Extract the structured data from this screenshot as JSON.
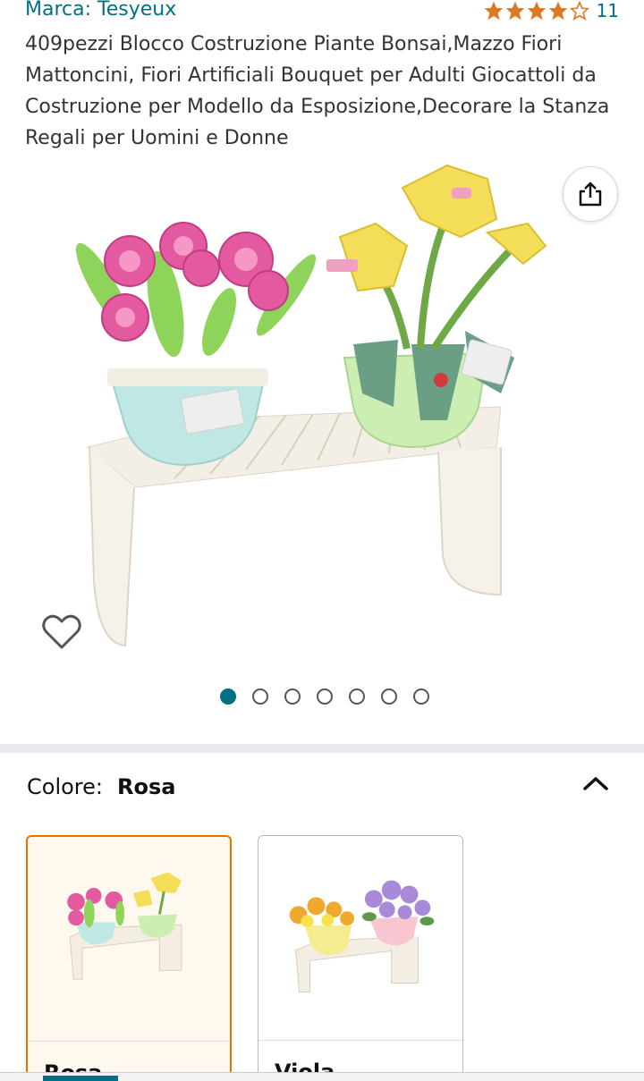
{
  "brand": {
    "label": "Marca: Tesyeux"
  },
  "rating": {
    "stars": 4.5,
    "count": "11",
    "star_color": "#de7921"
  },
  "product": {
    "title": "409pezzi Blocco Costruzione Piante Bonsai,Mazzo Fiori Mattoncini, Fiori Artificiali Bouquet per Adulti Giocattoli da Costruzione per Modello da Esposizione,Decorare la Stanza Regali per Uomini e Donne"
  },
  "gallery": {
    "image_count": 7,
    "active_index": 0,
    "icons": {
      "share": "share-icon",
      "wishlist": "heart-icon"
    }
  },
  "variation": {
    "label": "Colore:",
    "selected": "Rosa",
    "options": [
      {
        "label": "Rosa",
        "selected": true
      },
      {
        "label": "Viola",
        "selected": false
      }
    ]
  },
  "colors": {
    "link": "#007185",
    "selected_border": "#e77600"
  }
}
